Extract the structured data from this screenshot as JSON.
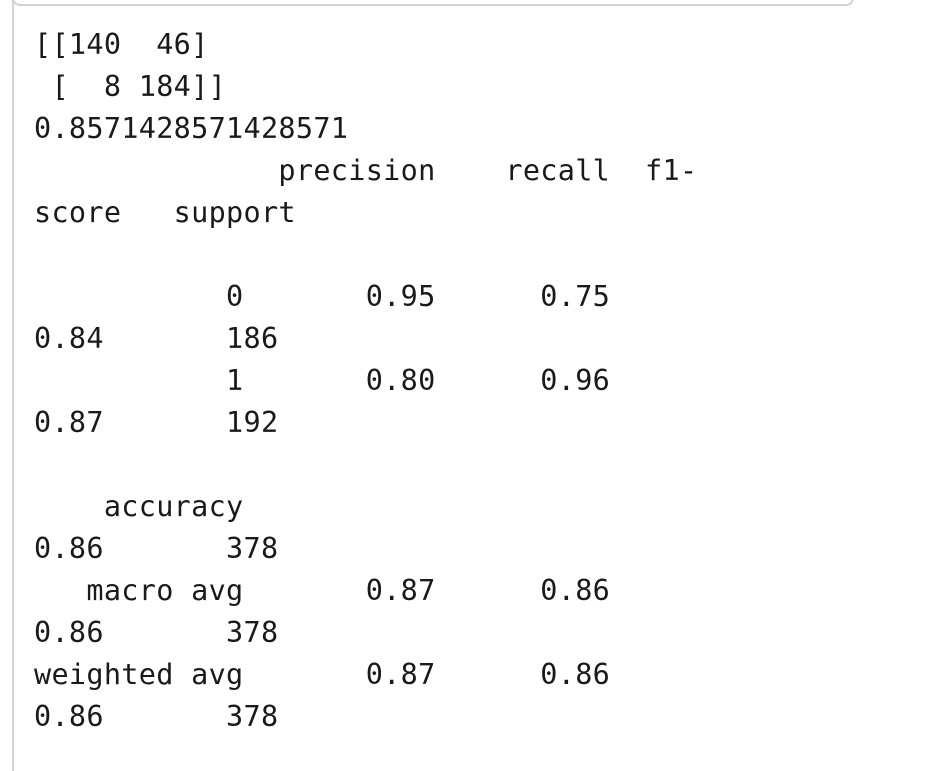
{
  "output": {
    "lines": [
      "[[140  46]",
      " [  8 184]]",
      "0.8571428571428571",
      "              precision    recall  f1-",
      "score   support",
      "",
      "           0       0.95      0.75",
      "0.84       186",
      "           1       0.80      0.96",
      "0.87       192",
      "",
      "    accuracy",
      "0.86       378",
      "   macro avg       0.87      0.86",
      "0.86       378",
      "weighted avg       0.87      0.86",
      "0.86       378"
    ]
  }
}
